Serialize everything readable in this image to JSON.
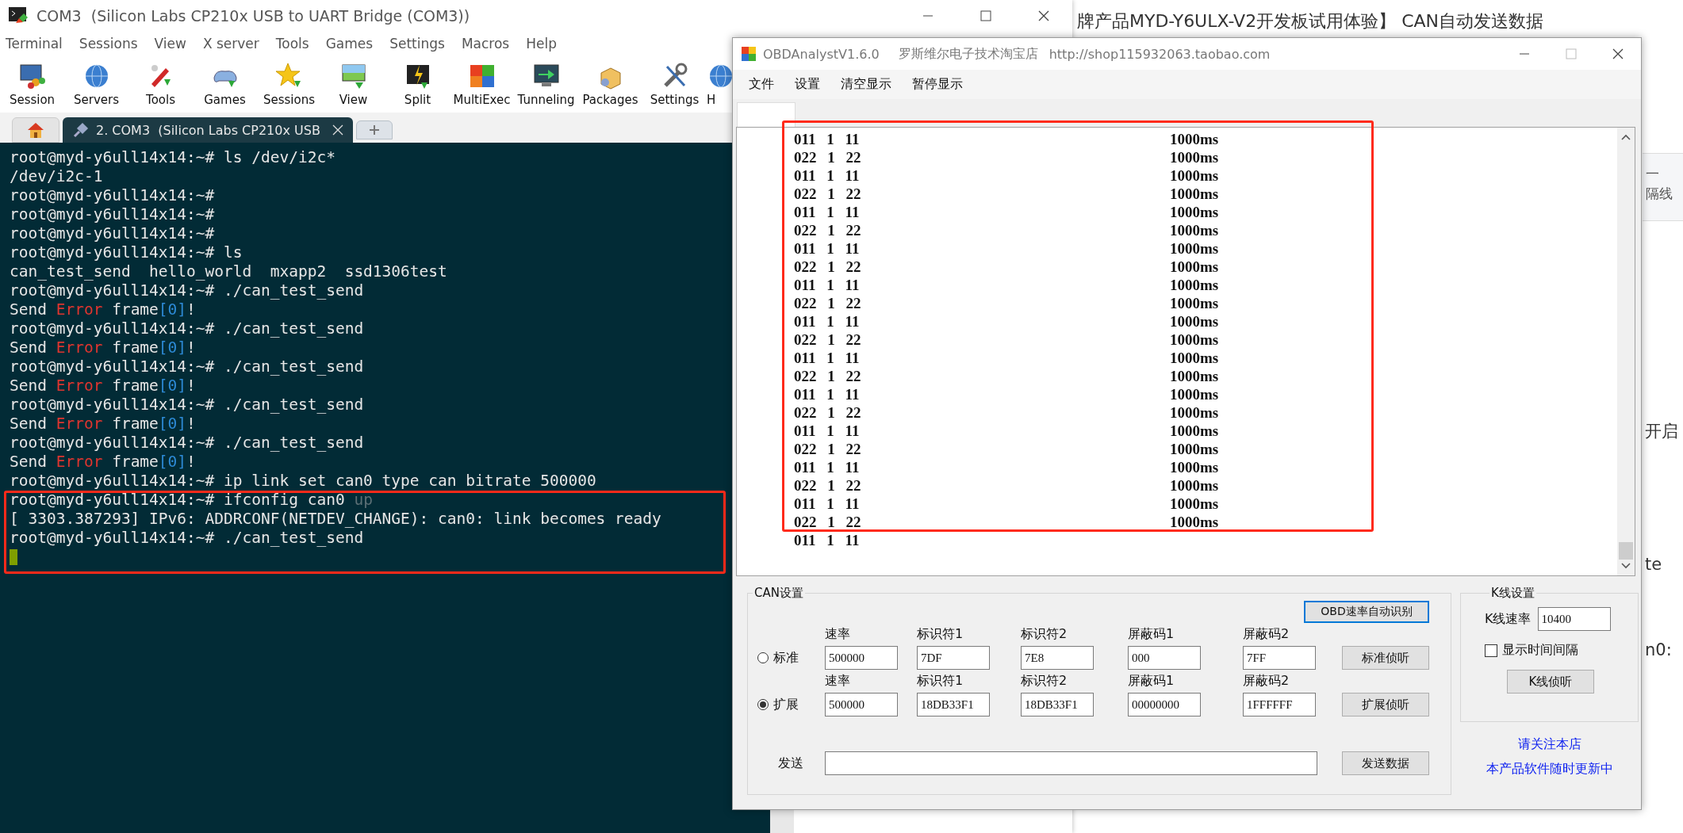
{
  "terminal_window": {
    "title": "COM3  (Silicon Labs CP210x USB to UART Bridge (COM3))",
    "menu": [
      "Terminal",
      "Sessions",
      "View",
      "X server",
      "Tools",
      "Games",
      "Settings",
      "Macros",
      "Help"
    ],
    "toolbar": [
      {
        "label": "Session"
      },
      {
        "label": "Servers"
      },
      {
        "label": "Tools"
      },
      {
        "label": "Games"
      },
      {
        "label": "Sessions"
      },
      {
        "label": "View"
      },
      {
        "label": "Split"
      },
      {
        "label": "MultiExec"
      },
      {
        "label": "Tunneling"
      },
      {
        "label": "Packages"
      },
      {
        "label": "Settings"
      },
      {
        "label": "H"
      }
    ],
    "tabs": [
      {
        "kind": "home",
        "selected": false
      },
      {
        "kind": "session",
        "label": "2. COM3  (Silicon Labs CP210x USB",
        "selected": true
      },
      {
        "kind": "new",
        "selected": false
      }
    ],
    "lines": [
      [
        {
          "kind": "plain",
          "text": "root@myd-y6ull14x14:~# ls /dev/i2c*"
        }
      ],
      [
        {
          "kind": "plain",
          "text": "/dev/i2c-1"
        }
      ],
      [
        {
          "kind": "plain",
          "text": "root@myd-y6ull14x14:~#"
        }
      ],
      [
        {
          "kind": "plain",
          "text": "root@myd-y6ull14x14:~#"
        }
      ],
      [
        {
          "kind": "plain",
          "text": "root@myd-y6ull14x14:~#"
        }
      ],
      [
        {
          "kind": "plain",
          "text": "root@myd-y6ull14x14:~# ls"
        }
      ],
      [
        {
          "kind": "plain",
          "text": "can_test_send  hello_world  mxapp2  ssd1306test"
        }
      ],
      [
        {
          "kind": "plain",
          "text": "root@myd-y6ull14x14:~# ./can_test_send"
        }
      ],
      [
        {
          "kind": "plain",
          "text": "Send "
        },
        {
          "kind": "error",
          "text": "Error"
        },
        {
          "kind": "plain",
          "text": " frame"
        },
        {
          "kind": "bracket",
          "text": "[0]"
        },
        {
          "kind": "plain",
          "text": "!"
        }
      ],
      [
        {
          "kind": "plain",
          "text": "root@myd-y6ull14x14:~# ./can_test_send"
        }
      ],
      [
        {
          "kind": "plain",
          "text": "Send "
        },
        {
          "kind": "error",
          "text": "Error"
        },
        {
          "kind": "plain",
          "text": " frame"
        },
        {
          "kind": "bracket",
          "text": "[0]"
        },
        {
          "kind": "plain",
          "text": "!"
        }
      ],
      [
        {
          "kind": "plain",
          "text": "root@myd-y6ull14x14:~# ./can_test_send"
        }
      ],
      [
        {
          "kind": "plain",
          "text": "Send "
        },
        {
          "kind": "error",
          "text": "Error"
        },
        {
          "kind": "plain",
          "text": " frame"
        },
        {
          "kind": "bracket",
          "text": "[0]"
        },
        {
          "kind": "plain",
          "text": "!"
        }
      ],
      [
        {
          "kind": "plain",
          "text": "root@myd-y6ull14x14:~# ./can_test_send"
        }
      ],
      [
        {
          "kind": "plain",
          "text": "Send "
        },
        {
          "kind": "error",
          "text": "Error"
        },
        {
          "kind": "plain",
          "text": " frame"
        },
        {
          "kind": "bracket",
          "text": "[0]"
        },
        {
          "kind": "plain",
          "text": "!"
        }
      ],
      [
        {
          "kind": "plain",
          "text": "root@myd-y6ull14x14:~# ./can_test_send"
        }
      ],
      [
        {
          "kind": "plain",
          "text": "Send "
        },
        {
          "kind": "error",
          "text": "Error"
        },
        {
          "kind": "plain",
          "text": " frame"
        },
        {
          "kind": "bracket",
          "text": "[0]"
        },
        {
          "kind": "plain",
          "text": "!"
        }
      ],
      [
        {
          "kind": "plain",
          "text": "root@myd-y6ull14x14:~# ip link set can0 type can bitrate 500000"
        }
      ],
      [
        {
          "kind": "plain",
          "text": "root@myd-y6ull14x14:~# ifconfig can0 "
        },
        {
          "kind": "dim",
          "text": "up"
        }
      ],
      [
        {
          "kind": "plain",
          "text": "[ 3303.387293] IPv6: ADDRCONF(NETDEV_CHANGE): can0: link becomes ready"
        }
      ],
      [
        {
          "kind": "plain",
          "text": "root@myd-y6ull14x14:~# ./can_test_send"
        }
      ]
    ]
  },
  "obd_window": {
    "title": "OBDAnalystV1.6.0",
    "shop": "罗斯维尔电子技术淘宝店",
    "url": "http://shop115932063.taobao.com",
    "menu": [
      "文件",
      "设置",
      "清空显示",
      "暂停显示"
    ],
    "frames": [
      {
        "frame": "011 1 11",
        "period": "1000ms"
      },
      {
        "frame": "022 1 22",
        "period": "1000ms"
      },
      {
        "frame": "011 1 11",
        "period": "1000ms"
      },
      {
        "frame": "022 1 22",
        "period": "1000ms"
      },
      {
        "frame": "011 1 11",
        "period": "1000ms"
      },
      {
        "frame": "022 1 22",
        "period": "1000ms"
      },
      {
        "frame": "011 1 11",
        "period": "1000ms"
      },
      {
        "frame": "022 1 22",
        "period": "1000ms"
      },
      {
        "frame": "011 1 11",
        "period": "1000ms"
      },
      {
        "frame": "022 1 22",
        "period": "1000ms"
      },
      {
        "frame": "011 1 11",
        "period": "1000ms"
      },
      {
        "frame": "022 1 22",
        "period": "1000ms"
      },
      {
        "frame": "011 1 11",
        "period": "1000ms"
      },
      {
        "frame": "022 1 22",
        "period": "1000ms"
      },
      {
        "frame": "011 1 11",
        "period": "1000ms"
      },
      {
        "frame": "022 1 22",
        "period": "1000ms"
      },
      {
        "frame": "011 1 11",
        "period": "1000ms"
      },
      {
        "frame": "022 1 22",
        "period": "1000ms"
      },
      {
        "frame": "011 1 11",
        "period": "1000ms"
      },
      {
        "frame": "022 1 22",
        "period": "1000ms"
      },
      {
        "frame": "011 1 11",
        "period": "1000ms"
      },
      {
        "frame": "022 1 22",
        "period": "1000ms"
      },
      {
        "frame": "011 1 11"
      }
    ],
    "can_settings": {
      "title": "CAN设置",
      "auto_detect_button": "OBD速率自动识别",
      "modes": [
        {
          "label": "标准",
          "selected": false,
          "fields": [
            {
              "label": "速率",
              "value": "500000"
            },
            {
              "label": "标识符1",
              "value": "7DF"
            },
            {
              "label": "标识符2",
              "value": "7E8"
            },
            {
              "label": "屏蔽码1",
              "value": "000"
            },
            {
              "label": "屏蔽码2",
              "value": "7FF"
            }
          ],
          "button": "标准侦听"
        },
        {
          "label": "扩展",
          "selected": true,
          "fields": [
            {
              "label": "速率",
              "value": "500000"
            },
            {
              "label": "标识符1",
              "value": "18DB33F1"
            },
            {
              "label": "标识符2",
              "value": "18DB33F1"
            },
            {
              "label": "屏蔽码1",
              "value": "00000000"
            },
            {
              "label": "屏蔽码2",
              "value": "1FFFFFF"
            }
          ],
          "button": "扩展侦听"
        }
      ],
      "send": {
        "label": "发送",
        "button": "发送数据"
      }
    },
    "k_line_settings": {
      "title": "K线设置",
      "rate_label": "K线速率",
      "rate_value": "10400",
      "show_interval": {
        "label": "显示时间间隔",
        "checked": false
      },
      "button": "K线侦听"
    },
    "links": [
      "请关注本店",
      "本产品软件随时更新中"
    ]
  },
  "browser": {
    "headline": "牌产品MYD-Y6ULX-V2开发板试用体验】 CAN自动发送数据",
    "side_tab": [
      "一",
      "隔线"
    ],
    "fragments": [
      "开启",
      "te",
      "n0:"
    ]
  }
}
